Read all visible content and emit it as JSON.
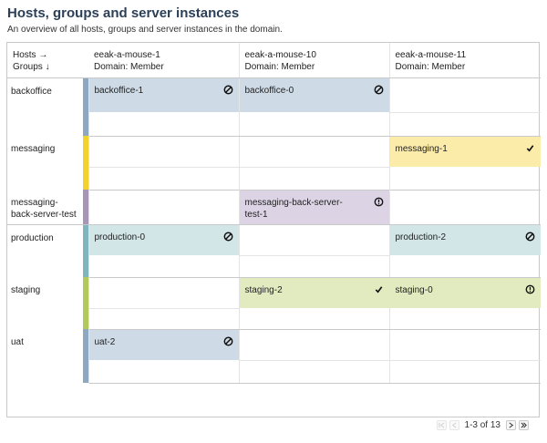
{
  "page": {
    "title": "Hosts, groups and server instances",
    "subtitle": "An overview of all hosts, groups and server instances in the domain."
  },
  "header": {
    "corner_line1": "Hosts →",
    "corner_line2": "Groups ↓",
    "hosts": [
      {
        "name": "eeak-a-mouse-1",
        "domain": "Domain: Member"
      },
      {
        "name": "eeak-a-mouse-10",
        "domain": "Domain: Member"
      },
      {
        "name": "eeak-a-mouse-11",
        "domain": "Domain: Member"
      }
    ]
  },
  "colors": {
    "backoffice": "#8fa8c2",
    "messaging": "#f2d32e",
    "messaging-back-server-test": "#a896b7",
    "production": "#7fb5bc",
    "staging": "#b4c95b",
    "uat": "#8fa8c2",
    "fill_blue": "#cedbe7",
    "fill_yellow": "#fcecaa",
    "fill_purple": "#dcd4e5",
    "fill_teal": "#d2e5e7",
    "fill_green": "#e2eac0"
  },
  "groups": [
    {
      "name": "backoffice",
      "cells": [
        {
          "label": "backoffice-1",
          "status": "stopped-icon"
        },
        {
          "label": "backoffice-0",
          "status": "stopped-icon"
        },
        null
      ]
    },
    {
      "name": "messaging",
      "cells": [
        null,
        null,
        {
          "label": "messaging-1",
          "status": "check-icon"
        }
      ]
    },
    {
      "name": "messaging-back-server-test",
      "display": "messaging-\nback-server-test",
      "cells": [
        null,
        {
          "label": "messaging-back-server-test-1",
          "display": "messaging-back-server-\ntest-1",
          "status": "warning-icon"
        },
        null
      ]
    },
    {
      "name": "production",
      "cells": [
        {
          "label": "production-0",
          "status": "stopped-icon"
        },
        null,
        {
          "label": "production-2",
          "status": "stopped-icon"
        }
      ]
    },
    {
      "name": "staging",
      "cells": [
        null,
        {
          "label": "staging-2",
          "status": "check-icon"
        },
        {
          "label": "staging-0",
          "status": "warning-icon"
        }
      ]
    },
    {
      "name": "uat",
      "cells": [
        {
          "label": "uat-2",
          "status": "stopped-icon"
        },
        null,
        null
      ]
    }
  ],
  "pager": {
    "text": "1-3 of 13",
    "first_icon": "first-page-icon",
    "prev_icon": "prev-page-icon",
    "next_icon": "next-page-icon",
    "last_icon": "last-page-icon"
  }
}
